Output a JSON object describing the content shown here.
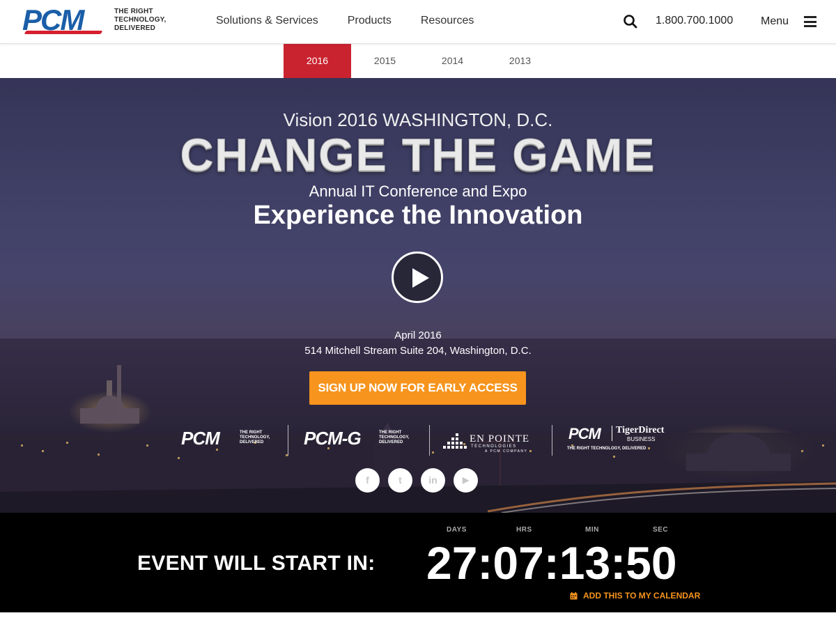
{
  "header": {
    "logo": {
      "mark": "PCM",
      "tagline_lines": [
        "THE RIGHT",
        "TECHNOLOGY,",
        "DELIVERED"
      ]
    },
    "nav": [
      {
        "label": "Solutions & Services"
      },
      {
        "label": "Products"
      },
      {
        "label": "Resources"
      }
    ],
    "search_icon": "search-icon",
    "phone": "1.800.700.1000",
    "menu_label": "Menu",
    "menu_icon": "hamburger-icon"
  },
  "year_tabs": [
    {
      "label": "2016",
      "active": true
    },
    {
      "label": "2015",
      "active": false
    },
    {
      "label": "2014",
      "active": false
    },
    {
      "label": "2013",
      "active": false
    }
  ],
  "hero": {
    "eyebrow": "Vision 2016 WASHINGTON, D.C.",
    "headline": "CHANGE THE GAME",
    "subheadline": "Annual IT Conference and Expo",
    "tagline": "Experience the Innovation",
    "play_icon": "play-icon",
    "date": "April 2016",
    "address": "514 Mitchell Stream Suite 204, Washington, D.C.",
    "cta_label": "SIGN UP NOW FOR EARLY ACCESS",
    "cta_color": "#f7941d",
    "partners": [
      {
        "name": "PCM",
        "tagline_lines": [
          "THE RIGHT",
          "TECHNOLOGY,",
          "DELIVERED"
        ]
      },
      {
        "name": "PCM-G",
        "tagline_lines": [
          "THE RIGHT",
          "TECHNOLOGY,",
          "DELIVERED"
        ]
      },
      {
        "name": "EN POINTE",
        "sub": "TECHNOLOGIES",
        "sub2": "A PCM COMPANY"
      },
      {
        "name": "PCM",
        "name2": "TigerDirect",
        "name3": "BUSINESS",
        "sub": "THE RIGHT TECHNOLOGY, DELIVERED"
      }
    ],
    "socials": [
      {
        "icon": "facebook-icon",
        "glyph": "f"
      },
      {
        "icon": "twitter-icon",
        "glyph": "t"
      },
      {
        "icon": "linkedin-icon",
        "glyph": "in"
      },
      {
        "icon": "youtube-icon",
        "glyph": "▶"
      }
    ]
  },
  "countdown": {
    "label": "EVENT WILL START IN:",
    "units": [
      "DAYS",
      "HRS",
      "MIN",
      "SEC"
    ],
    "time": "27:07:13:50",
    "calendar_label": "ADD THIS TO MY CALENDAR",
    "calendar_icon": "calendar-icon"
  },
  "colors": {
    "brand_blue": "#1b5ea8",
    "brand_red": "#c9232f",
    "accent_orange": "#f7941d"
  }
}
